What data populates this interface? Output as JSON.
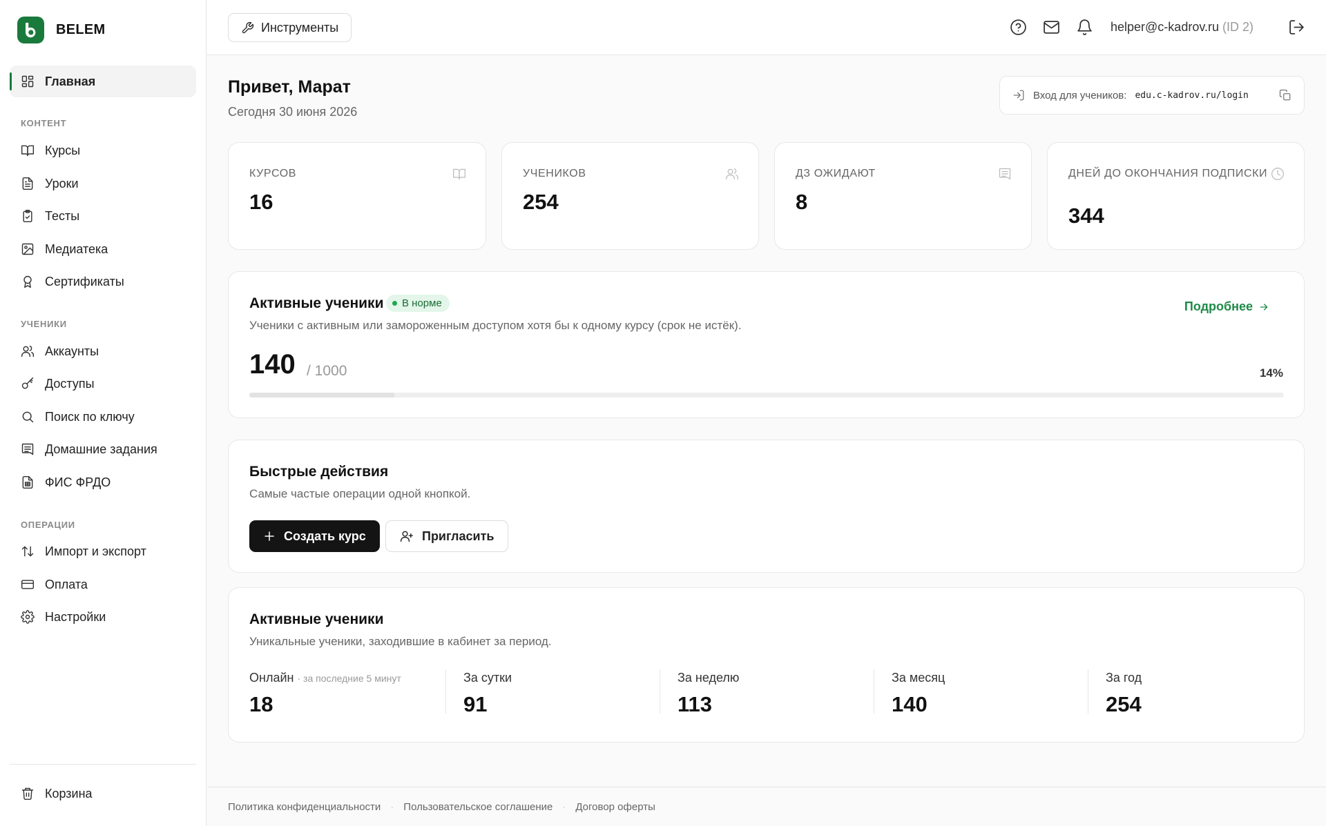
{
  "brand": {
    "name": "BELEM",
    "logo_letter": "b",
    "color": "#1a7a3c"
  },
  "sidebar": {
    "main": {
      "label": "Главная",
      "icon": "dashboard-icon"
    },
    "sections": [
      {
        "title": "КОНТЕНТ",
        "items": [
          {
            "label": "Курсы",
            "icon": "book-icon"
          },
          {
            "label": "Уроки",
            "icon": "document-icon"
          },
          {
            "label": "Тесты",
            "icon": "clipboard-check-icon"
          },
          {
            "label": "Медиатека",
            "icon": "image-icon"
          },
          {
            "label": "Сертификаты",
            "icon": "award-icon"
          }
        ]
      },
      {
        "title": "УЧЕНИКИ",
        "items": [
          {
            "label": "Аккаунты",
            "icon": "users-icon"
          },
          {
            "label": "Доступы",
            "icon": "key-icon"
          },
          {
            "label": "Поиск по ключу",
            "icon": "search-icon"
          },
          {
            "label": "Домашние задания",
            "icon": "message-square-icon"
          },
          {
            "label": "ФИС ФРДО",
            "icon": "file-table-icon"
          }
        ]
      },
      {
        "title": "ОПЕРАЦИИ",
        "items": [
          {
            "label": "Импорт и экспорт",
            "icon": "arrows-up-down-icon"
          },
          {
            "label": "Оплата",
            "icon": "credit-card-icon"
          },
          {
            "label": "Настройки",
            "icon": "gear-icon"
          }
        ]
      }
    ],
    "trash": {
      "label": "Корзина",
      "icon": "trash-icon"
    }
  },
  "topbar": {
    "tools_label": "Инструменты",
    "user_email": "helper@c-kadrov.ru",
    "user_id": "(ID 2)"
  },
  "greeting": {
    "title": "Привет, Марат",
    "date": "Сегодня 30 июня 2026"
  },
  "student_login": {
    "label": "Вход для учеников:",
    "url": "edu.c-kadrov.ru/login"
  },
  "stats": [
    {
      "label": "КУРСОВ",
      "value": "16",
      "icon": "book-icon"
    },
    {
      "label": "УЧЕНИКОВ",
      "value": "254",
      "icon": "users-icon"
    },
    {
      "label": "ДЗ ОЖИДАЮТ",
      "value": "8",
      "icon": "message-square-icon"
    },
    {
      "label": "ДНЕЙ ДО ОКОНЧАНИЯ ПОДПИСКИ",
      "value": "344",
      "icon": "clock-icon"
    }
  ],
  "active_limit": {
    "title": "Активные ученики",
    "badge": "В норме",
    "subtitle": "Ученики с активным или замороженным доступом хотя бы к одному курсу (срок не истёк).",
    "more_label": "Подробнее",
    "value": "140",
    "total": "/ 1000",
    "percent_label": "14%",
    "percent": 14
  },
  "quick_actions": {
    "title": "Быстрые действия",
    "subtitle": "Самые частые операции одной кнопкой.",
    "create_label": "Создать курс",
    "invite_label": "Пригласить"
  },
  "active_period": {
    "title": "Активные ученики",
    "subtitle": "Уникальные ученики, заходившие в кабинет за период.",
    "periods": [
      {
        "label": "Онлайн",
        "hint": "· за последние 5 минут",
        "value": "18"
      },
      {
        "label": "За сутки",
        "hint": "",
        "value": "91"
      },
      {
        "label": "За неделю",
        "hint": "",
        "value": "113"
      },
      {
        "label": "За месяц",
        "hint": "",
        "value": "140"
      },
      {
        "label": "За год",
        "hint": "",
        "value": "254"
      }
    ]
  },
  "footer": {
    "links": [
      "Политика конфиденциальности",
      "Пользовательское соглашение",
      "Договор оферты"
    ]
  }
}
